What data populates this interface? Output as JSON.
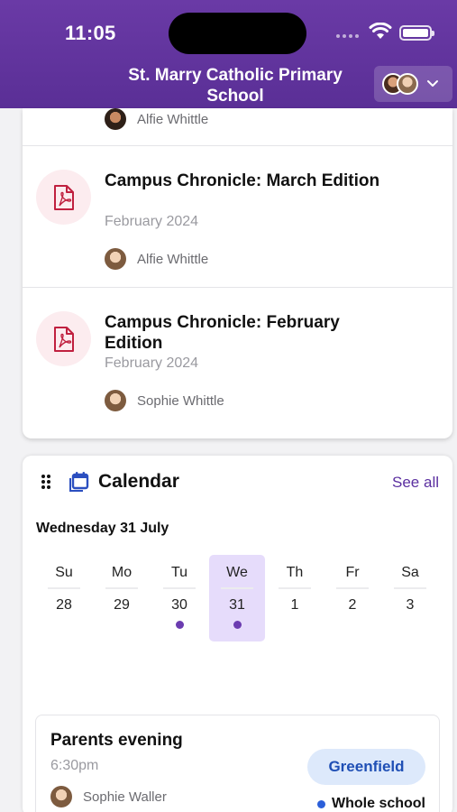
{
  "status_bar": {
    "time": "11:05"
  },
  "header": {
    "title": "St. Marry Catholic Primary School",
    "switcher_icon": "chevron-down-icon"
  },
  "documents": {
    "top_author": "Alfie Whittle",
    "items": [
      {
        "title": "Campus Chronicle: March Edition",
        "date": "February 2024",
        "author": "Alfie Whittle",
        "icon": "pdf-icon"
      },
      {
        "title": "Campus Chronicle: February Edition",
        "date": "February 2024",
        "author": "Sophie Whittle",
        "icon": "pdf-icon"
      }
    ]
  },
  "calendar": {
    "title": "Calendar",
    "see_all": "See all",
    "selected_date": "Wednesday 31 July",
    "days": [
      {
        "name": "Su",
        "num": "28",
        "has_event": false,
        "selected": false
      },
      {
        "name": "Mo",
        "num": "29",
        "has_event": false,
        "selected": false
      },
      {
        "name": "Tu",
        "num": "30",
        "has_event": true,
        "selected": false
      },
      {
        "name": "We",
        "num": "31",
        "has_event": true,
        "selected": true
      },
      {
        "name": "Th",
        "num": "1",
        "has_event": false,
        "selected": false
      },
      {
        "name": "Fr",
        "num": "2",
        "has_event": false,
        "selected": false
      },
      {
        "name": "Sa",
        "num": "3",
        "has_event": false,
        "selected": false
      }
    ],
    "event": {
      "title": "Parents evening",
      "time": "6:30pm",
      "author": "Sophie Waller",
      "tag": "Greenfield",
      "scope": "Whole school"
    }
  },
  "colors": {
    "header": "#5a2f96",
    "accent": "#5b2fa0",
    "selected_day": "#e6dcfb",
    "event_dot": "#6b3cb0",
    "pdf_red": "#c0203f",
    "tag_bg": "#dde9fb",
    "tag_text": "#1f4fb5"
  }
}
